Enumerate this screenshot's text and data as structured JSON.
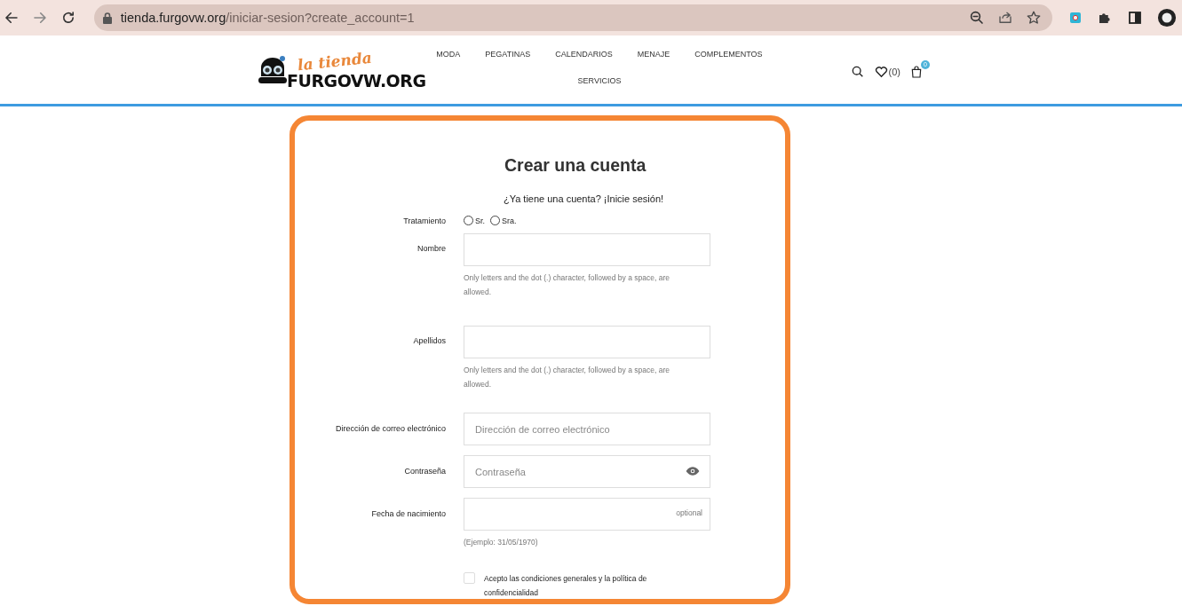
{
  "browser": {
    "url_host": "tienda.furgovw.org",
    "url_path": "/iniciar-sesion?create_account=1"
  },
  "header": {
    "logo": {
      "script": "la tienda",
      "wordmark": "FURGOVW.ORG"
    },
    "nav": [
      "MODA",
      "PEGATINAS",
      "CALENDARIOS",
      "MENAJE",
      "COMPLEMENTOS",
      "SERVICIOS"
    ],
    "wishlist_count": "(0)",
    "cart_badge": "0"
  },
  "form": {
    "title": "Crear una cuenta",
    "login_prompt": "¿Ya tiene una cuenta? ¡Inicie sesión!",
    "fields": [
      {
        "kind": "radio",
        "label": "Tratamiento",
        "options": [
          {
            "label": "Sr.",
            "selected": false
          },
          {
            "label": "Sra.",
            "selected": false
          }
        ]
      },
      {
        "kind": "text",
        "label": "Nombre",
        "hint": "Only letters and the dot (.) character, followed by a space, are allowed."
      },
      {
        "kind": "text",
        "label": "Apellidos",
        "hint": "Only letters and the dot (.) character, followed by a space, are allowed."
      },
      {
        "kind": "email",
        "label": "Dirección de correo electrónico",
        "placeholder": "Dirección de correo electrónico"
      },
      {
        "kind": "password",
        "label": "Contraseña",
        "placeholder": "Contraseña"
      },
      {
        "kind": "date",
        "label": "Fecha de nacimiento",
        "suffix": "optional",
        "hint": "(Ejemplo: 31/05/1970)"
      }
    ],
    "terms": {
      "label": "Acepto las condiciones generales y la política de confidencialidad",
      "checked": false
    }
  }
}
